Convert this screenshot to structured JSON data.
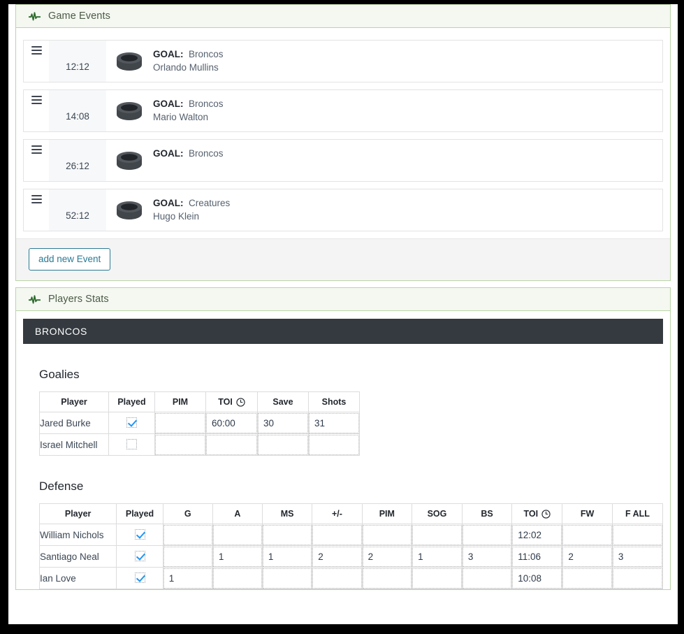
{
  "panels": {
    "game_events": {
      "title": "Game Events",
      "icon": "pulse-icon",
      "add_button": "add new Event",
      "events": [
        {
          "handle": "drag-handle",
          "time": "12:12",
          "icon": "puck-icon",
          "type": "GOAL:",
          "team": "Broncos",
          "player": "Orlando Mullins"
        },
        {
          "handle": "drag-handle",
          "time": "14:08",
          "icon": "puck-icon",
          "type": "GOAL:",
          "team": "Broncos",
          "player": "Mario Walton"
        },
        {
          "handle": "drag-handle",
          "time": "26:12",
          "icon": "puck-icon",
          "type": "GOAL:",
          "team": "Broncos",
          "player": ""
        },
        {
          "handle": "drag-handle",
          "time": "52:12",
          "icon": "puck-icon",
          "type": "GOAL:",
          "team": "Creatures",
          "player": "Hugo Klein"
        }
      ]
    },
    "players_stats": {
      "title": "Players Stats",
      "icon": "pulse-icon",
      "team": "BRONCOS",
      "sections": [
        {
          "title": "Goalies",
          "columns": [
            "Player",
            "Played",
            "PIM",
            "TOI",
            "Save",
            "Shots"
          ],
          "clock_column": "TOI",
          "rows": [
            {
              "player": "Jared Burke",
              "played": true,
              "values": [
                "",
                "60:00",
                "30",
                "31"
              ]
            },
            {
              "player": "Israel Mitchell",
              "played": false,
              "values": [
                "",
                "",
                "",
                ""
              ]
            }
          ]
        },
        {
          "title": "Defense",
          "columns": [
            "Player",
            "Played",
            "G",
            "A",
            "MS",
            "+/-",
            "PIM",
            "SOG",
            "BS",
            "TOI",
            "FW",
            "F ALL"
          ],
          "clock_column": "TOI",
          "rows": [
            {
              "player": "William Nichols",
              "played": true,
              "values": [
                "",
                "",
                "",
                "",
                "",
                "",
                "",
                "12:02",
                "",
                ""
              ]
            },
            {
              "player": "Santiago Neal",
              "played": true,
              "values": [
                "",
                "1",
                "1",
                "2",
                "2",
                "1",
                "3",
                "11:06",
                "2",
                "3"
              ]
            },
            {
              "player": "Ian Love",
              "played": true,
              "values": [
                "1",
                "",
                "",
                "",
                "",
                "",
                "",
                "10:08",
                "",
                ""
              ]
            }
          ]
        }
      ]
    }
  },
  "colors": {
    "panel_border": "#bcd4a8",
    "panel_head_bg": "#f4f8f1",
    "panel_head_text": "#4c5a45",
    "team_bar_bg": "#343a40",
    "button_accent": "#2b7a94",
    "checkbox_accent": "#2196f3"
  }
}
